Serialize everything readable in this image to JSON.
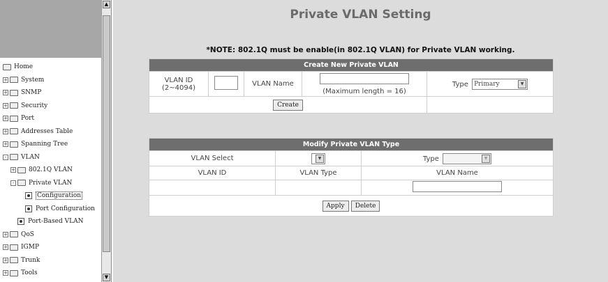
{
  "sidebar": {
    "items": [
      {
        "label": "Home",
        "level": 0,
        "kind": "folder-open",
        "expander": ""
      },
      {
        "label": "System",
        "level": 0,
        "kind": "folder",
        "expander": "+"
      },
      {
        "label": "SNMP",
        "level": 0,
        "kind": "folder",
        "expander": "+"
      },
      {
        "label": "Security",
        "level": 0,
        "kind": "folder",
        "expander": "+"
      },
      {
        "label": "Port",
        "level": 0,
        "kind": "folder",
        "expander": "+"
      },
      {
        "label": "Addresses Table",
        "level": 0,
        "kind": "folder",
        "expander": "+"
      },
      {
        "label": "Spanning Tree",
        "level": 0,
        "kind": "folder",
        "expander": "+"
      },
      {
        "label": "VLAN",
        "level": 0,
        "kind": "folder-open",
        "expander": "-"
      },
      {
        "label": "802.1Q VLAN",
        "level": 1,
        "kind": "folder",
        "expander": "+"
      },
      {
        "label": "Private VLAN",
        "level": 1,
        "kind": "folder-open",
        "expander": "-"
      },
      {
        "label": "Configuration",
        "level": 2,
        "kind": "page",
        "expander": "",
        "selected": true
      },
      {
        "label": "Port Configuration",
        "level": 2,
        "kind": "page",
        "expander": ""
      },
      {
        "label": "Port-Based VLAN",
        "level": 1,
        "kind": "page",
        "expander": ""
      },
      {
        "label": "QoS",
        "level": 0,
        "kind": "folder",
        "expander": "+"
      },
      {
        "label": "IGMP",
        "level": 0,
        "kind": "folder",
        "expander": "+"
      },
      {
        "label": "Trunk",
        "level": 0,
        "kind": "folder",
        "expander": "+"
      },
      {
        "label": "Tools",
        "level": 0,
        "kind": "folder",
        "expander": "+"
      }
    ]
  },
  "main": {
    "title": "Private VLAN Setting",
    "note": "*NOTE: 802.1Q must be enable(in 802.1Q VLAN) for Private VLAN working.",
    "create": {
      "header": "Create New Private VLAN",
      "vlan_id_label": "VLAN ID",
      "vlan_id_range": "(2~4094)",
      "vlan_id_value": "",
      "vlan_name_label": "VLAN Name",
      "vlan_name_value": "",
      "max_length_hint": "(Maximum length = 16)",
      "type_label": "Type",
      "type_value": "Primary",
      "create_button": "Create"
    },
    "modify": {
      "header": "Modify Private VLAN Type",
      "vlan_select_label": "VLAN Select",
      "vlan_select_value": "",
      "type_label": "Type",
      "type_value": "",
      "col_vlan_id": "VLAN ID",
      "col_vlan_type": "VLAN Type",
      "col_vlan_name": "VLAN Name",
      "vlan_name_value": "",
      "apply_button": "Apply",
      "delete_button": "Delete"
    }
  }
}
